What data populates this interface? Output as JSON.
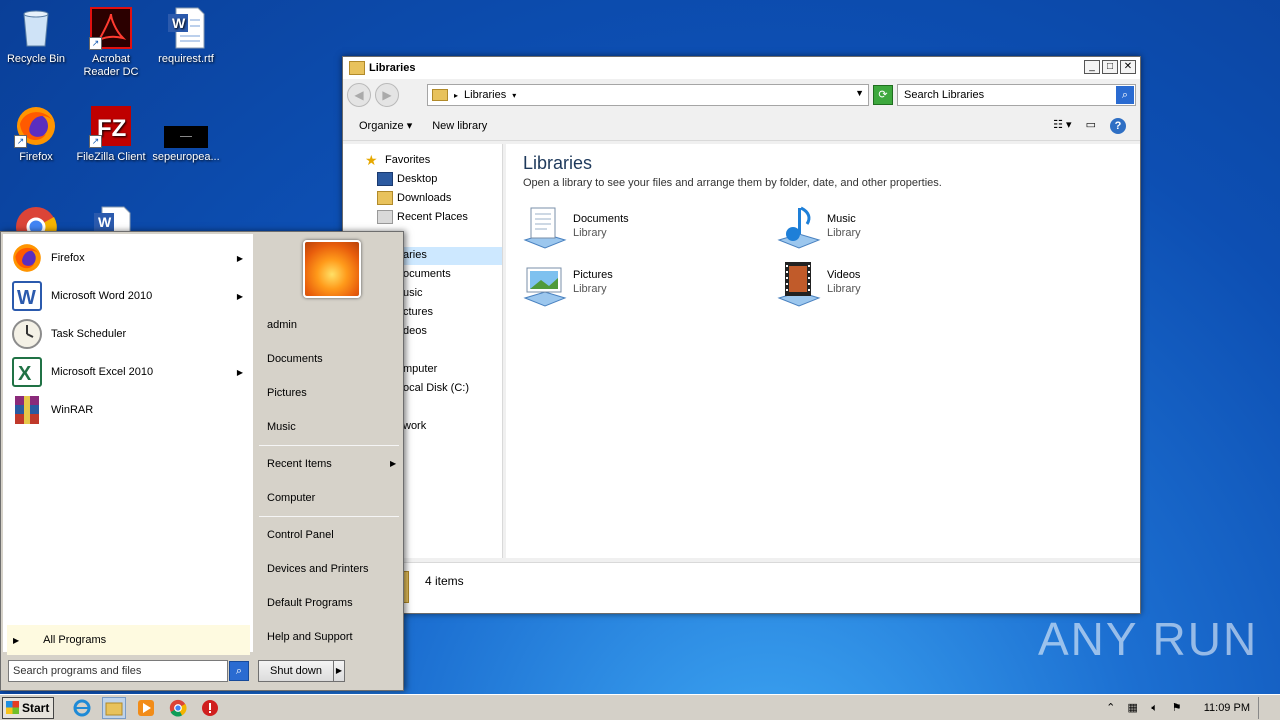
{
  "desktop": {
    "icons": [
      {
        "label": "Recycle Bin"
      },
      {
        "label": "Acrobat Reader DC"
      },
      {
        "label": "requirest.rtf"
      },
      {
        "label": "Firefox"
      },
      {
        "label": "FileZilla Client"
      },
      {
        "label": "sepeuropea..."
      }
    ]
  },
  "explorer": {
    "title": "Libraries",
    "address": "Libraries",
    "search_placeholder": "Search Libraries",
    "toolbar": {
      "organize": "Organize",
      "new_library": "New library"
    },
    "nav": [
      {
        "label": "Favorites"
      },
      {
        "label": "Desktop"
      },
      {
        "label": "Downloads"
      },
      {
        "label": "Recent Places"
      },
      {
        "label": "aries"
      },
      {
        "label": "ocuments"
      },
      {
        "label": "usic"
      },
      {
        "label": "ctures"
      },
      {
        "label": "deos"
      },
      {
        "label": "mputer"
      },
      {
        "label": "ocal Disk (C:)"
      },
      {
        "label": "work"
      }
    ],
    "heading": "Libraries",
    "subheading": "Open a library to see your files and arrange them by folder, date, and other properties.",
    "libraries": [
      {
        "name": "Documents",
        "kind": "Library"
      },
      {
        "name": "Music",
        "kind": "Library"
      },
      {
        "name": "Pictures",
        "kind": "Library"
      },
      {
        "name": "Videos",
        "kind": "Library"
      }
    ],
    "status": "4 items"
  },
  "startmenu": {
    "programs": [
      {
        "label": "Firefox",
        "icon": "firefox-icon"
      },
      {
        "label": "Microsoft Word 2010",
        "icon": "word-icon"
      },
      {
        "label": "Task Scheduler",
        "icon": "clock-icon"
      },
      {
        "label": "Microsoft Excel 2010",
        "icon": "excel-icon"
      },
      {
        "label": "WinRAR",
        "icon": "winrar-icon"
      }
    ],
    "all_programs": "All Programs",
    "search_placeholder": "Search programs and files",
    "right_links": [
      {
        "label": "admin"
      },
      {
        "label": "Documents"
      },
      {
        "label": "Pictures"
      },
      {
        "label": "Music"
      },
      {
        "label": "Recent Items"
      },
      {
        "label": "Computer"
      },
      {
        "label": "Control Panel"
      },
      {
        "label": "Devices and Printers"
      },
      {
        "label": "Default Programs"
      },
      {
        "label": "Help and Support"
      }
    ],
    "shutdown": "Shut down"
  },
  "taskbar": {
    "start": "Start",
    "clock": "11:09 PM"
  },
  "watermark": "ANY RUN"
}
